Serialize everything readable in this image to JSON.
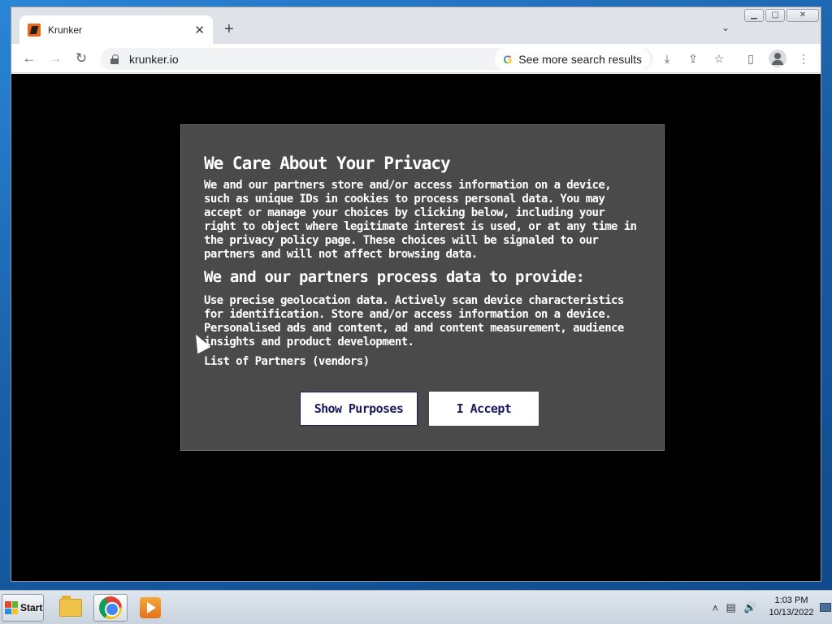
{
  "browser": {
    "tab": {
      "title": "Krunker",
      "close_glyph": "✕"
    },
    "new_tab_glyph": "+",
    "tab_search_glyph": "⌄",
    "window_controls": {
      "minimize": "▁",
      "maximize": "▢",
      "close": "✕"
    },
    "nav": {
      "back": "←",
      "forward": "→",
      "reload": "↻"
    },
    "address": {
      "url": "krunker.io"
    },
    "search_chip": {
      "g_letter": "G",
      "label": "See more search results"
    },
    "toolbar_icons": {
      "install": "⤓",
      "share": "⇪",
      "bookmark": "☆",
      "sidepanel": "▯",
      "menu": "⋮"
    }
  },
  "consent": {
    "title": "We Care About Your Privacy",
    "body": "We and our partners store and/or access information on a device, such as unique IDs in cookies to process personal data. You may accept or manage your choices by clicking below, including your right to object where legitimate interest is used, or at any time in the privacy policy page. These choices will be signaled to our partners and will not affect browsing data.",
    "subtitle": "We and our partners process data to provide:",
    "purposes": "Use precise geolocation data. Actively scan device characteristics for identification. Store and/or access information on a device. Personalised ads and content, ad and content measurement, audience insights and product development.",
    "partners_link": "List of Partners (vendors)",
    "show_purposes_button": "Show Purposes",
    "accept_button": "I Accept"
  },
  "taskbar": {
    "start_label": "Start",
    "tray_chevron": "˄",
    "tray_network": "▤",
    "tray_volume": "🔊",
    "time": "1:03 PM",
    "date": "10/13/2022"
  },
  "colors": {
    "dialog_bg": "#4a4a4a",
    "page_bg": "#000000",
    "button_text": "#1a1a5e"
  }
}
